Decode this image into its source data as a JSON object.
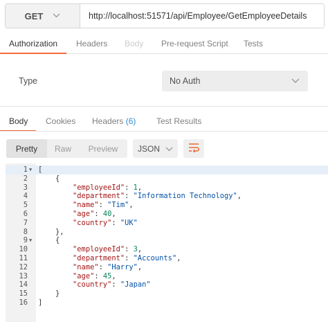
{
  "request": {
    "method": "GET",
    "url": "http://localhost:51571/api/Employee/GetEmployeeDetails"
  },
  "request_tabs": [
    {
      "label": "Authorization",
      "state": "active"
    },
    {
      "label": "Headers",
      "state": "normal"
    },
    {
      "label": "Body",
      "state": "disabled"
    },
    {
      "label": "Pre-request Script",
      "state": "normal"
    },
    {
      "label": "Tests",
      "state": "normal"
    }
  ],
  "auth": {
    "type_label": "Type",
    "selected": "No Auth"
  },
  "response_tabs": {
    "body": "Body",
    "cookies": "Cookies",
    "headers": "Headers",
    "headers_count": "(6)",
    "test_results": "Test Results"
  },
  "toolbar": {
    "pretty": "Pretty",
    "raw": "Raw",
    "preview": "Preview",
    "format": "JSON"
  },
  "colors": {
    "accent": "#f26b3a",
    "badge": "#2c8ed6",
    "json_key": "#a31515",
    "json_string": "#0451a5",
    "json_number": "#098658"
  },
  "code_lines": [
    {
      "n": "1",
      "fold": true,
      "hl": true,
      "indent": "",
      "p": [
        [
          "p",
          "["
        ]
      ]
    },
    {
      "n": "2",
      "fold": false,
      "hl": false,
      "indent": "    ",
      "p": [
        [
          "p",
          "{"
        ]
      ]
    },
    {
      "n": "3",
      "fold": false,
      "hl": false,
      "indent": "        ",
      "p": [
        [
          "k",
          "\"employeeId\""
        ],
        [
          "p",
          ": "
        ],
        [
          "n",
          "1"
        ],
        [
          "p",
          ","
        ]
      ]
    },
    {
      "n": "4",
      "fold": false,
      "hl": false,
      "indent": "        ",
      "p": [
        [
          "k",
          "\"department\""
        ],
        [
          "p",
          ": "
        ],
        [
          "s",
          "\"Information Technology\""
        ],
        [
          "p",
          ","
        ]
      ]
    },
    {
      "n": "5",
      "fold": false,
      "hl": false,
      "indent": "        ",
      "p": [
        [
          "k",
          "\"name\""
        ],
        [
          "p",
          ": "
        ],
        [
          "s",
          "\"Tim\""
        ],
        [
          "p",
          ","
        ]
      ]
    },
    {
      "n": "6",
      "fold": false,
      "hl": false,
      "indent": "        ",
      "p": [
        [
          "k",
          "\"age\""
        ],
        [
          "p",
          ": "
        ],
        [
          "n",
          "40"
        ],
        [
          "p",
          ","
        ]
      ]
    },
    {
      "n": "7",
      "fold": false,
      "hl": false,
      "indent": "        ",
      "p": [
        [
          "k",
          "\"country\""
        ],
        [
          "p",
          ": "
        ],
        [
          "s",
          "\"UK\""
        ]
      ]
    },
    {
      "n": "8",
      "fold": false,
      "hl": false,
      "indent": "    ",
      "p": [
        [
          "p",
          "},"
        ]
      ]
    },
    {
      "n": "9",
      "fold": true,
      "hl": false,
      "indent": "    ",
      "p": [
        [
          "p",
          "{"
        ]
      ]
    },
    {
      "n": "10",
      "fold": false,
      "hl": false,
      "indent": "        ",
      "p": [
        [
          "k",
          "\"employeeId\""
        ],
        [
          "p",
          ": "
        ],
        [
          "n",
          "3"
        ],
        [
          "p",
          ","
        ]
      ]
    },
    {
      "n": "11",
      "fold": false,
      "hl": false,
      "indent": "        ",
      "p": [
        [
          "k",
          "\"department\""
        ],
        [
          "p",
          ": "
        ],
        [
          "s",
          "\"Accounts\""
        ],
        [
          "p",
          ","
        ]
      ]
    },
    {
      "n": "12",
      "fold": false,
      "hl": false,
      "indent": "        ",
      "p": [
        [
          "k",
          "\"name\""
        ],
        [
          "p",
          ": "
        ],
        [
          "s",
          "\"Harry\""
        ],
        [
          "p",
          ","
        ]
      ]
    },
    {
      "n": "13",
      "fold": false,
      "hl": false,
      "indent": "        ",
      "p": [
        [
          "k",
          "\"age\""
        ],
        [
          "p",
          ": "
        ],
        [
          "n",
          "45"
        ],
        [
          "p",
          ","
        ]
      ]
    },
    {
      "n": "14",
      "fold": false,
      "hl": false,
      "indent": "        ",
      "p": [
        [
          "k",
          "\"country\""
        ],
        [
          "p",
          ": "
        ],
        [
          "s",
          "\"Japan\""
        ]
      ]
    },
    {
      "n": "15",
      "fold": false,
      "hl": false,
      "indent": "    ",
      "p": [
        [
          "p",
          "}"
        ]
      ]
    },
    {
      "n": "16",
      "fold": false,
      "hl": false,
      "indent": "",
      "p": [
        [
          "p",
          "]"
        ]
      ]
    }
  ]
}
